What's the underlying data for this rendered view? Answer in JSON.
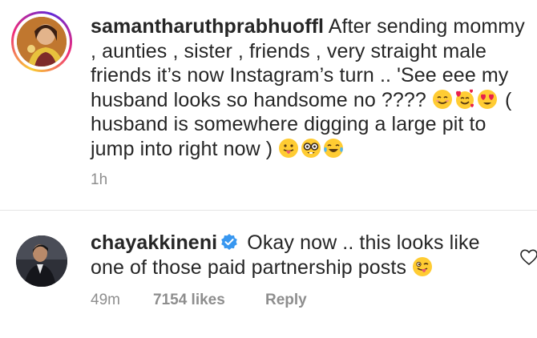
{
  "caption": {
    "username": "samantharuthprabhuoffl",
    "text_part1": "After sending mommy , aunties , sister , friends , very straight male friends it’s now Instagram’s turn .. 'See eee my husband looks so handsome no ????",
    "text_part2": "( husband is somewhere digging a large pit to jump into right now )",
    "time": "1h",
    "emoji_set_1": [
      "smiling-face-icon",
      "smiling-face-with-hearts-icon",
      "heart-eyes-icon"
    ],
    "emoji_set_2": [
      "tongue-out-icon",
      "nerd-face-icon",
      "tears-of-joy-icon"
    ]
  },
  "comment": {
    "username": "chayakkineni",
    "verified_icon": "verified-badge-icon",
    "text": "Okay now .. this looks like one of those paid partnership posts",
    "emoji": "winking-tongue-icon",
    "time": "49m",
    "likes": "7154 likes",
    "reply": "Reply",
    "like_icon": "heart-outline-icon"
  },
  "colors": {
    "text": "#262626",
    "meta": "#8e8e8e",
    "verified": "#3897f0",
    "divider": "#e6e6e6"
  }
}
